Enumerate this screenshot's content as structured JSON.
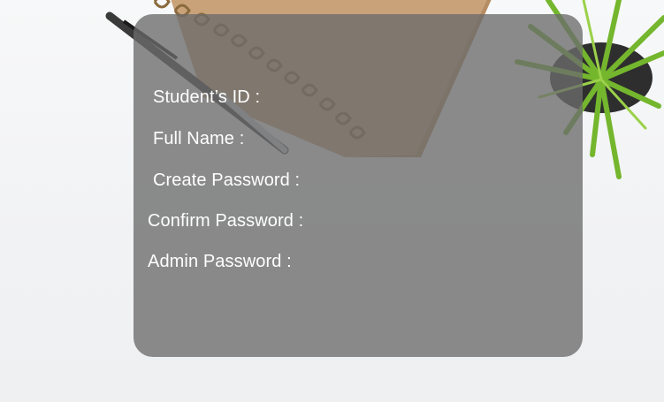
{
  "form": {
    "labels": {
      "student_id": "Student’s ID :",
      "full_name": "Full Name :",
      "create_password": "Create Password :",
      "confirm_password": "Confirm Password :",
      "admin_password": "Admin Password :"
    }
  },
  "colors": {
    "panel_overlay": "#6c6c6c",
    "label_text": "#ffffff",
    "notebook": "#c9a27a",
    "plant_leaf": "#7cb82f",
    "background": "#f4f5f6"
  },
  "decor": {
    "icons": [
      "notebook-image",
      "pen-image",
      "plant-image"
    ]
  }
}
